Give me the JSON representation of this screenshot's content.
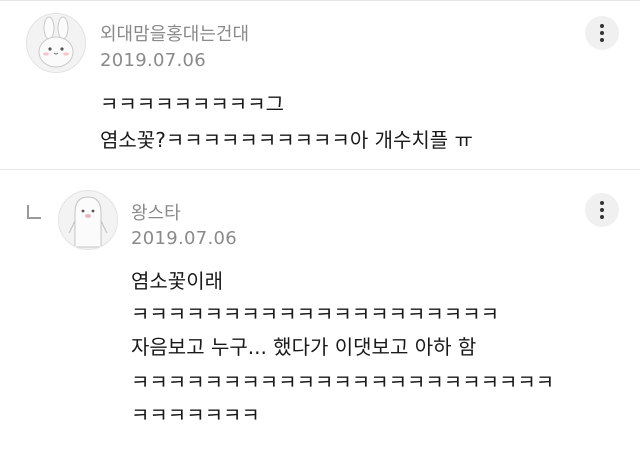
{
  "comments": [
    {
      "author": "외대맘을홍대는건대",
      "date": "2019.07.06",
      "avatar_icon": "rabbit-icon",
      "lines": [
        "ㅋㅋㅋㅋㅋㅋㅋㅋㅋ그",
        "염소꽃?ㅋㅋㅋㅋㅋㅋㅋㅋㅋㅋ아 개수치플 ㅠ"
      ]
    },
    {
      "author": "왕스타",
      "date": "2019.07.06",
      "avatar_icon": "penguin-icon",
      "reply_icon": "reply-arrow-icon",
      "lines": [
        "염소꽃이래",
        "ㅋㅋㅋㅋㅋㅋㅋㅋㅋㅋㅋㅋㅋㅋㅋㅋㅋㅋㅋㅋ",
        "자음보고 누구... 했다가 이댓보고 아하 함",
        "ㅋㅋㅋㅋㅋㅋㅋㅋㅋㅋㅋㅋㅋㅋㅋㅋㅋㅋㅋㅋㅋㅋㅋ",
        "ㅋㅋㅋㅋㅋㅋㅋ"
      ]
    }
  ],
  "more_icon": "more-vertical-icon"
}
